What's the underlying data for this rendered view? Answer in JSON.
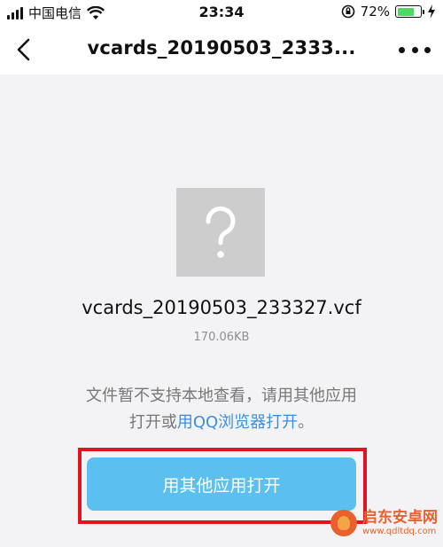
{
  "status_bar": {
    "carrier": "中国电信",
    "time": "23:34",
    "battery_percent": "72%",
    "battery_level": 0.72,
    "battery_color": "#4cd964"
  },
  "nav": {
    "title": "vcards_20190503_2333...",
    "back_icon": "chevron-left-icon",
    "more_icon": "more-dots-icon"
  },
  "file": {
    "icon": "unknown-file-question-icon",
    "name": "vcards_20190503_233327.vcf",
    "size": "170.06KB"
  },
  "notice": {
    "line1": "文件暂不支持本地查看，请用其他应用",
    "line2_prefix": "打开或",
    "line2_link": "用QQ浏览器打开",
    "line2_suffix": "。"
  },
  "open_button": {
    "label": "用其他应用打开",
    "color": "#5bc0f0"
  },
  "highlight_color": "#e0141e",
  "watermark": {
    "title": "启东安卓网",
    "url": "www.qdltdq.com"
  }
}
